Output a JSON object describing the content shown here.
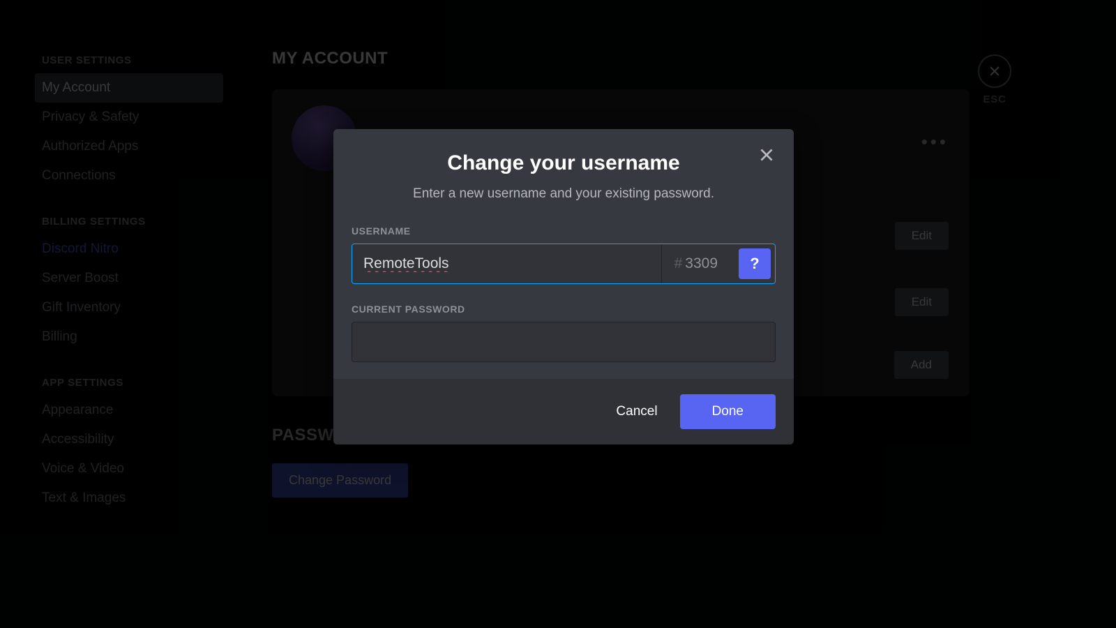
{
  "sidebar": {
    "groups": [
      {
        "header": "USER SETTINGS",
        "items": [
          {
            "label": "My Account",
            "active": true
          },
          {
            "label": "Privacy & Safety"
          },
          {
            "label": "Authorized Apps"
          },
          {
            "label": "Connections"
          }
        ]
      },
      {
        "header": "BILLING SETTINGS",
        "items": [
          {
            "label": "Discord Nitro",
            "accent": true
          },
          {
            "label": "Server Boost"
          },
          {
            "label": "Gift Inventory"
          },
          {
            "label": "Billing"
          }
        ]
      },
      {
        "header": "APP SETTINGS",
        "items": [
          {
            "label": "Appearance"
          },
          {
            "label": "Accessibility"
          },
          {
            "label": "Voice & Video"
          },
          {
            "label": "Text & Images"
          }
        ]
      }
    ]
  },
  "main": {
    "title": "MY ACCOUNT",
    "buttons": {
      "edit": "Edit",
      "add": "Add"
    },
    "section_auth": "PASSWORD AND AUTHENTICATION",
    "change_password": "Change Password"
  },
  "close": {
    "esc": "ESC"
  },
  "modal": {
    "title": "Change your username",
    "subtitle": "Enter a new username and your existing password.",
    "username_label": "USERNAME",
    "username_value": "RemoteTools",
    "discriminator_hash": "#",
    "discriminator": "3309",
    "help": "?",
    "password_label": "CURRENT PASSWORD",
    "password_value": "",
    "cancel": "Cancel",
    "done": "Done"
  }
}
